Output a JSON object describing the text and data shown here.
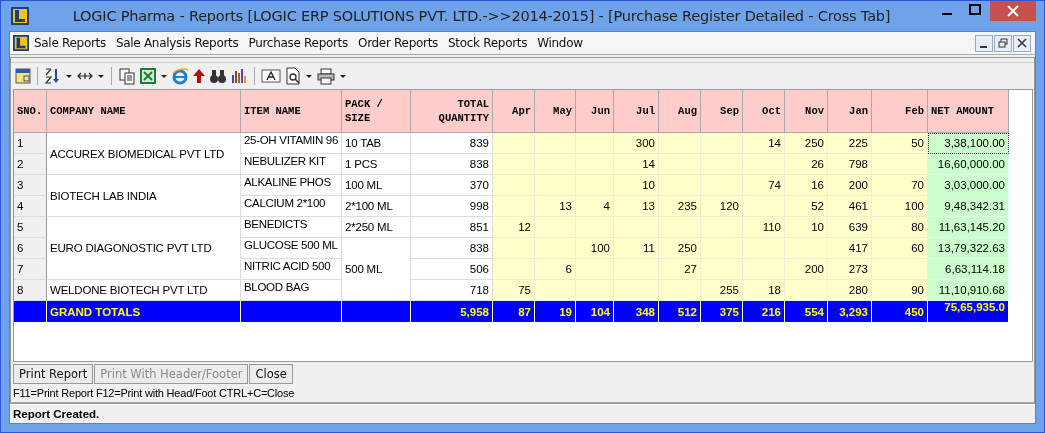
{
  "window": {
    "title": "LOGIC Pharma - Reports  [LOGIC ERP SOLUTIONS PVT. LTD.->>2014-2015] - [Purchase Register Detailed - Cross Tab]"
  },
  "menu": [
    "Sale Reports",
    "Sale Analysis Reports",
    "Purchase Reports",
    "Order Reports",
    "Stock Reports",
    "Window"
  ],
  "table": {
    "columns": [
      {
        "label": "SNO.",
        "kind": "text"
      },
      {
        "label": "COMPANY NAME",
        "kind": "text"
      },
      {
        "label": "ITEM NAME",
        "kind": "text"
      },
      {
        "label": "PACK / SIZE",
        "kind": "text"
      },
      {
        "label": "TOTAL QUANTITY",
        "kind": "number"
      },
      {
        "label": "Apr",
        "kind": "number"
      },
      {
        "label": "May",
        "kind": "number"
      },
      {
        "label": "Jun",
        "kind": "number"
      },
      {
        "label": "Jul",
        "kind": "number"
      },
      {
        "label": "Aug",
        "kind": "number"
      },
      {
        "label": "Sep",
        "kind": "number"
      },
      {
        "label": "Oct",
        "kind": "number"
      },
      {
        "label": "Nov",
        "kind": "number"
      },
      {
        "label": "Jan",
        "kind": "number"
      },
      {
        "label": "Feb",
        "kind": "number"
      },
      {
        "label": "NET AMOUNT",
        "kind": "text"
      }
    ],
    "companies": [
      {
        "name": "ACCUREX BIOMEDICAL PVT LTD",
        "rows": [
          {
            "sno": "1",
            "item": "25-OH VITAMIN 96",
            "pack": "10 TAB",
            "total": "839",
            "months": {
              "jul": "300",
              "oct": "14",
              "nov": "250",
              "jan": "225",
              "feb": "50"
            },
            "net": "3,38,100.00",
            "focused": true
          },
          {
            "sno": "2",
            "item": "NEBULIZER KIT",
            "pack": "1 PCS",
            "total": "838",
            "months": {
              "jul": "14",
              "nov": "26",
              "jan": "798"
            },
            "net": "16,60,000.00",
            "focused": false
          }
        ]
      },
      {
        "name": "BIOTECH LAB INDIA",
        "rows": [
          {
            "sno": "3",
            "item": "ALKALINE PHOS",
            "pack": "100 ML",
            "total": "370",
            "months": {
              "jul": "10",
              "oct": "74",
              "nov": "16",
              "jan": "200",
              "feb": "70"
            },
            "net": "3,03,000.00",
            "focused": false
          },
          {
            "sno": "4",
            "item": "CALCIUM 2*100",
            "pack": "2*100 ML",
            "total": "998",
            "months": {
              "may": "13",
              "jun": "4",
              "jul": "13",
              "aug": "235",
              "sep": "120",
              "nov": "52",
              "jan": "461",
              "feb": "100"
            },
            "net": "9,48,342.31",
            "focused": false
          }
        ]
      },
      {
        "name": "EURO DIAGONOSTIC PVT LTD",
        "rows": [
          {
            "sno": "5",
            "item": "BENEDICTS",
            "pack": "2*250 ML",
            "total": "851",
            "months": {
              "apr": "12",
              "oct": "110",
              "nov": "10",
              "jan": "639",
              "feb": "80"
            },
            "net": "11,63,145.20",
            "focused": false
          },
          {
            "sno": "6",
            "item": "GLUCOSE 500 ML",
            "pack": "500 ML",
            "total": "838",
            "months": {
              "jun": "100",
              "jul": "11",
              "aug": "250",
              "jan": "417",
              "feb": "60"
            },
            "net": "13,79,322.63",
            "focused": false
          },
          {
            "sno": "7",
            "item": "NITRIC ACID 500",
            "total": "506",
            "months": {
              "may": "6",
              "aug": "27",
              "nov": "200",
              "jan": "273"
            },
            "net": "6,63,114.18",
            "focused": false
          }
        ]
      },
      {
        "name": "WELDONE BIOTECH PVT LTD",
        "rows": [
          {
            "sno": "8",
            "item": "BLOOD BAG",
            "total": "718",
            "months": {
              "apr": "75",
              "sep": "255",
              "oct": "18",
              "jan": "280",
              "feb": "90"
            },
            "net": "11,10,910.68",
            "focused": false
          }
        ]
      }
    ],
    "totals": {
      "label": "GRAND TOTALS",
      "total": "5,958",
      "months": [
        "87",
        "19",
        "104",
        "348",
        "512",
        "375",
        "216",
        "554",
        "3,293",
        "450"
      ],
      "net": "75,65,935.0"
    }
  },
  "buttons": [
    {
      "label": "Print Report",
      "disabled": false
    },
    {
      "label": "Print With Header/Footer",
      "disabled": true
    },
    {
      "label": "Close",
      "disabled": false
    }
  ],
  "shortcuts": "F11=Print Report  F12=Print with Head/Foot  CTRL+C=Close",
  "status_bar": "Report Created."
}
